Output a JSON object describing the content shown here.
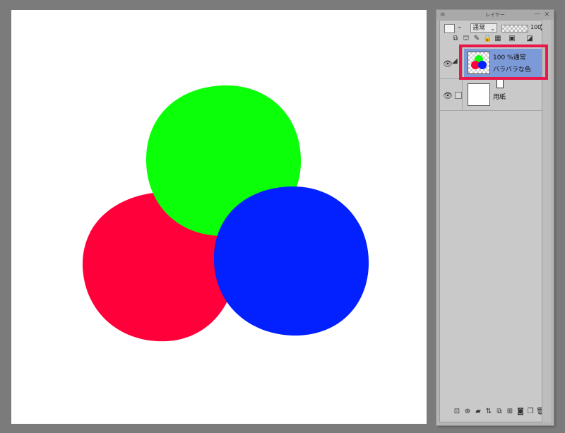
{
  "canvas": {
    "circles": [
      {
        "name": "red",
        "color": "#ff003a"
      },
      {
        "name": "green",
        "color": "#0aff08"
      },
      {
        "name": "blue",
        "color": "#0320ff"
      }
    ]
  },
  "panel": {
    "title": "レイヤー",
    "blend_mode": "通常",
    "opacity": "100",
    "layers": [
      {
        "mode": "100 %通常",
        "name": "バラバラな色",
        "selected": true
      },
      {
        "name": "用紙",
        "selected": false
      }
    ]
  },
  "highlight_color": "#e8194a",
  "icons": {
    "menu": "menu-icon",
    "close": "close-icon",
    "eye": "eye-icon"
  }
}
